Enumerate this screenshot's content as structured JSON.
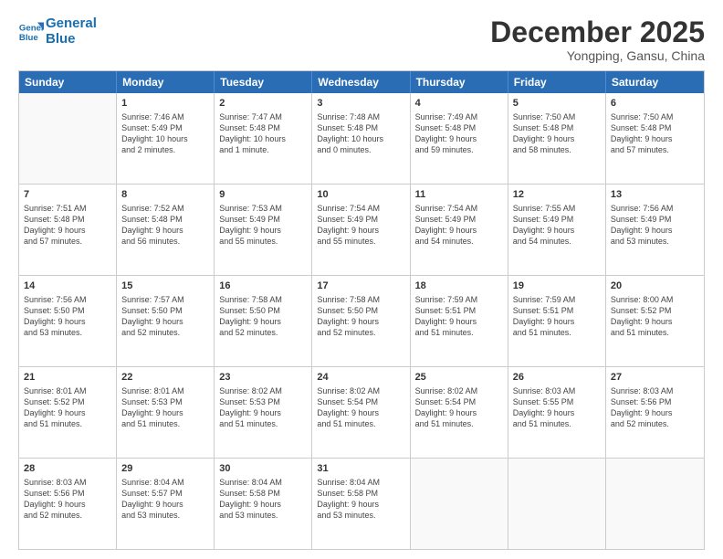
{
  "header": {
    "logo_line1": "General",
    "logo_line2": "Blue",
    "month": "December 2025",
    "location": "Yongping, Gansu, China"
  },
  "days_of_week": [
    "Sunday",
    "Monday",
    "Tuesday",
    "Wednesday",
    "Thursday",
    "Friday",
    "Saturday"
  ],
  "weeks": [
    [
      {
        "day": "",
        "info": ""
      },
      {
        "day": "1",
        "info": "Sunrise: 7:46 AM\nSunset: 5:49 PM\nDaylight: 10 hours\nand 2 minutes."
      },
      {
        "day": "2",
        "info": "Sunrise: 7:47 AM\nSunset: 5:48 PM\nDaylight: 10 hours\nand 1 minute."
      },
      {
        "day": "3",
        "info": "Sunrise: 7:48 AM\nSunset: 5:48 PM\nDaylight: 10 hours\nand 0 minutes."
      },
      {
        "day": "4",
        "info": "Sunrise: 7:49 AM\nSunset: 5:48 PM\nDaylight: 9 hours\nand 59 minutes."
      },
      {
        "day": "5",
        "info": "Sunrise: 7:50 AM\nSunset: 5:48 PM\nDaylight: 9 hours\nand 58 minutes."
      },
      {
        "day": "6",
        "info": "Sunrise: 7:50 AM\nSunset: 5:48 PM\nDaylight: 9 hours\nand 57 minutes."
      }
    ],
    [
      {
        "day": "7",
        "info": "Sunrise: 7:51 AM\nSunset: 5:48 PM\nDaylight: 9 hours\nand 57 minutes."
      },
      {
        "day": "8",
        "info": "Sunrise: 7:52 AM\nSunset: 5:48 PM\nDaylight: 9 hours\nand 56 minutes."
      },
      {
        "day": "9",
        "info": "Sunrise: 7:53 AM\nSunset: 5:49 PM\nDaylight: 9 hours\nand 55 minutes."
      },
      {
        "day": "10",
        "info": "Sunrise: 7:54 AM\nSunset: 5:49 PM\nDaylight: 9 hours\nand 55 minutes."
      },
      {
        "day": "11",
        "info": "Sunrise: 7:54 AM\nSunset: 5:49 PM\nDaylight: 9 hours\nand 54 minutes."
      },
      {
        "day": "12",
        "info": "Sunrise: 7:55 AM\nSunset: 5:49 PM\nDaylight: 9 hours\nand 54 minutes."
      },
      {
        "day": "13",
        "info": "Sunrise: 7:56 AM\nSunset: 5:49 PM\nDaylight: 9 hours\nand 53 minutes."
      }
    ],
    [
      {
        "day": "14",
        "info": "Sunrise: 7:56 AM\nSunset: 5:50 PM\nDaylight: 9 hours\nand 53 minutes."
      },
      {
        "day": "15",
        "info": "Sunrise: 7:57 AM\nSunset: 5:50 PM\nDaylight: 9 hours\nand 52 minutes."
      },
      {
        "day": "16",
        "info": "Sunrise: 7:58 AM\nSunset: 5:50 PM\nDaylight: 9 hours\nand 52 minutes."
      },
      {
        "day": "17",
        "info": "Sunrise: 7:58 AM\nSunset: 5:50 PM\nDaylight: 9 hours\nand 52 minutes."
      },
      {
        "day": "18",
        "info": "Sunrise: 7:59 AM\nSunset: 5:51 PM\nDaylight: 9 hours\nand 51 minutes."
      },
      {
        "day": "19",
        "info": "Sunrise: 7:59 AM\nSunset: 5:51 PM\nDaylight: 9 hours\nand 51 minutes."
      },
      {
        "day": "20",
        "info": "Sunrise: 8:00 AM\nSunset: 5:52 PM\nDaylight: 9 hours\nand 51 minutes."
      }
    ],
    [
      {
        "day": "21",
        "info": "Sunrise: 8:01 AM\nSunset: 5:52 PM\nDaylight: 9 hours\nand 51 minutes."
      },
      {
        "day": "22",
        "info": "Sunrise: 8:01 AM\nSunset: 5:53 PM\nDaylight: 9 hours\nand 51 minutes."
      },
      {
        "day": "23",
        "info": "Sunrise: 8:02 AM\nSunset: 5:53 PM\nDaylight: 9 hours\nand 51 minutes."
      },
      {
        "day": "24",
        "info": "Sunrise: 8:02 AM\nSunset: 5:54 PM\nDaylight: 9 hours\nand 51 minutes."
      },
      {
        "day": "25",
        "info": "Sunrise: 8:02 AM\nSunset: 5:54 PM\nDaylight: 9 hours\nand 51 minutes."
      },
      {
        "day": "26",
        "info": "Sunrise: 8:03 AM\nSunset: 5:55 PM\nDaylight: 9 hours\nand 51 minutes."
      },
      {
        "day": "27",
        "info": "Sunrise: 8:03 AM\nSunset: 5:56 PM\nDaylight: 9 hours\nand 52 minutes."
      }
    ],
    [
      {
        "day": "28",
        "info": "Sunrise: 8:03 AM\nSunset: 5:56 PM\nDaylight: 9 hours\nand 52 minutes."
      },
      {
        "day": "29",
        "info": "Sunrise: 8:04 AM\nSunset: 5:57 PM\nDaylight: 9 hours\nand 53 minutes."
      },
      {
        "day": "30",
        "info": "Sunrise: 8:04 AM\nSunset: 5:58 PM\nDaylight: 9 hours\nand 53 minutes."
      },
      {
        "day": "31",
        "info": "Sunrise: 8:04 AM\nSunset: 5:58 PM\nDaylight: 9 hours\nand 53 minutes."
      },
      {
        "day": "",
        "info": ""
      },
      {
        "day": "",
        "info": ""
      },
      {
        "day": "",
        "info": ""
      }
    ]
  ]
}
